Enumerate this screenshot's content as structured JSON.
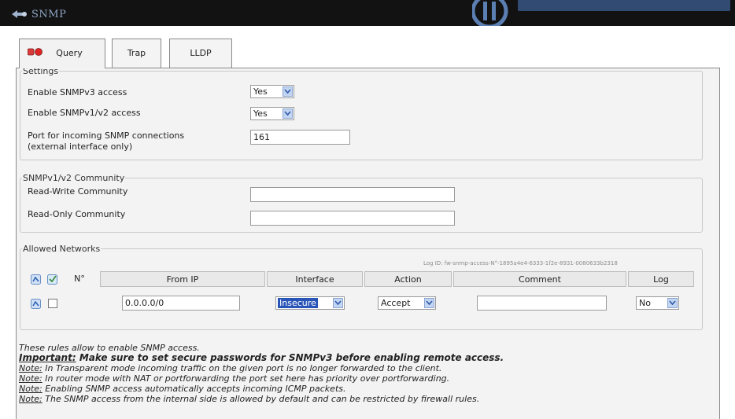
{
  "window": {
    "title": "SNMP"
  },
  "tabs": [
    {
      "label": "Query",
      "active": true
    },
    {
      "label": "Trap",
      "active": false
    },
    {
      "label": "LLDP",
      "active": false
    }
  ],
  "settings": {
    "legend": "Settings",
    "snmpv3_label": "Enable SNMPv3 access",
    "snmpv3_value": "Yes",
    "snmpv12_label": "Enable SNMPv1/v2 access",
    "snmpv12_value": "Yes",
    "port_label_line1": "Port for incoming SNMP connections",
    "port_label_line2": "(external interface only)",
    "port_value": "161"
  },
  "community": {
    "legend": "SNMPv1/v2 Community",
    "rw_label": "Read-Write Community",
    "rw_value": "",
    "ro_label": "Read-Only Community",
    "ro_value": ""
  },
  "networks": {
    "legend": "Allowed Networks",
    "log_id": "Log ID: fw-snmp-access-N°-1895a4e4-6333-1f2e-8931-0080633b2318",
    "columns": [
      "N°",
      "From IP",
      "Interface",
      "Action",
      "Comment",
      "Log"
    ],
    "rows": [
      {
        "no": "",
        "from_ip": "0.0.0.0/0",
        "interface": "Insecure",
        "action": "Accept",
        "comment": "",
        "log": "No"
      }
    ]
  },
  "notes": {
    "intro": "These rules allow to enable SNMP access.",
    "important_label": "Important:",
    "important_text": " Make sure to set secure passwords for SNMPv3 before enabling remote access.",
    "note_label": "Note:",
    "note1": " In Transparent mode incoming traffic on the given port is no longer forwarded to the client.",
    "note2": " In router mode with NAT or portforwarding the port set here has priority over portforwarding.",
    "note3": " Enabling SNMP access automatically accepts incoming ICMP packets.",
    "note4": " The SNMP access from the internal side is allowed by default and can be restricted by firewall rules."
  },
  "colors": {
    "accent": "#c3d5f2",
    "selected_highlight": "#2a55b8",
    "topbar": "#121212"
  },
  "icons": [
    "snmp-icon",
    "status-lights-icon",
    "add-rule-icon",
    "select-all-icon",
    "chevron-down-icon",
    "brand-logo"
  ]
}
